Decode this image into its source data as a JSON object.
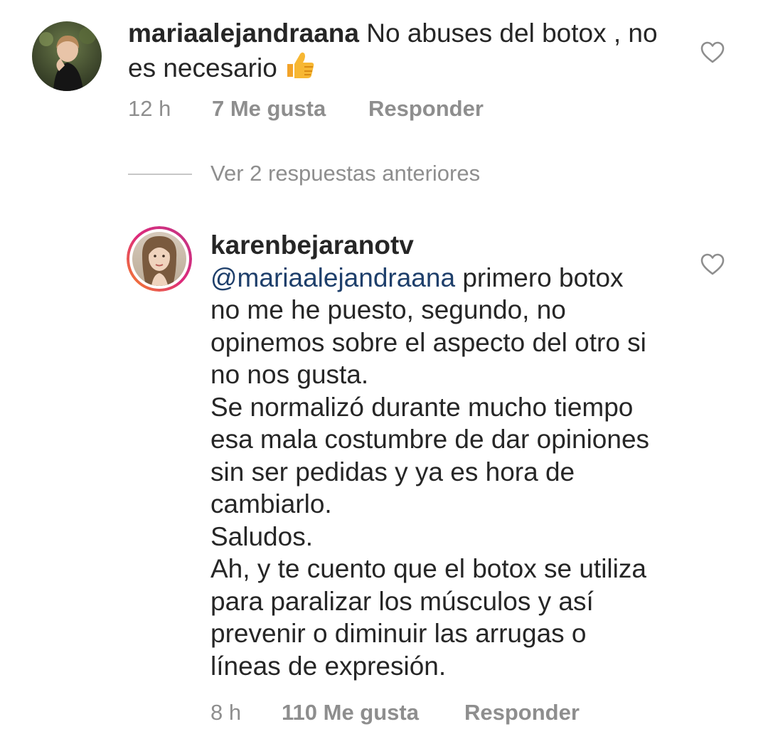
{
  "comments": [
    {
      "username": "mariaalejandraana",
      "text_line1": "No abuses del botox , no",
      "text_line2": "es necesario",
      "emoji": "thumbs-up",
      "time": "12 h",
      "likes": "7 Me gusta",
      "reply_label": "Responder"
    },
    {
      "username": "karenbejaranotv",
      "mention": "@mariaalejandraana",
      "lines": [
        " primero botox",
        "no me he puesto, segundo, no",
        "opinemos sobre el aspecto del otro si",
        "no nos gusta.",
        "Se normalizó durante mucho tiempo",
        "esa mala costumbre de dar opiniones",
        "sin ser pedidas y ya es hora de",
        "cambiarlo.",
        "Saludos.",
        "Ah, y te cuento que el botox se utiliza",
        "para paralizar los músculos y así",
        "prevenir o diminuir las arrugas o",
        "líneas de expresión."
      ],
      "time": "8 h",
      "likes": "110 Me gusta",
      "reply_label": "Responder"
    }
  ],
  "replies_toggle": {
    "label": "Ver 2 respuestas anteriores"
  },
  "colors": {
    "text": "#262626",
    "meta": "#8e8e8e",
    "mention": "#1e3f6b",
    "story_ring_start": "#f58529",
    "story_ring_end": "#c13584",
    "emoji_yellow": "#f7b733"
  }
}
